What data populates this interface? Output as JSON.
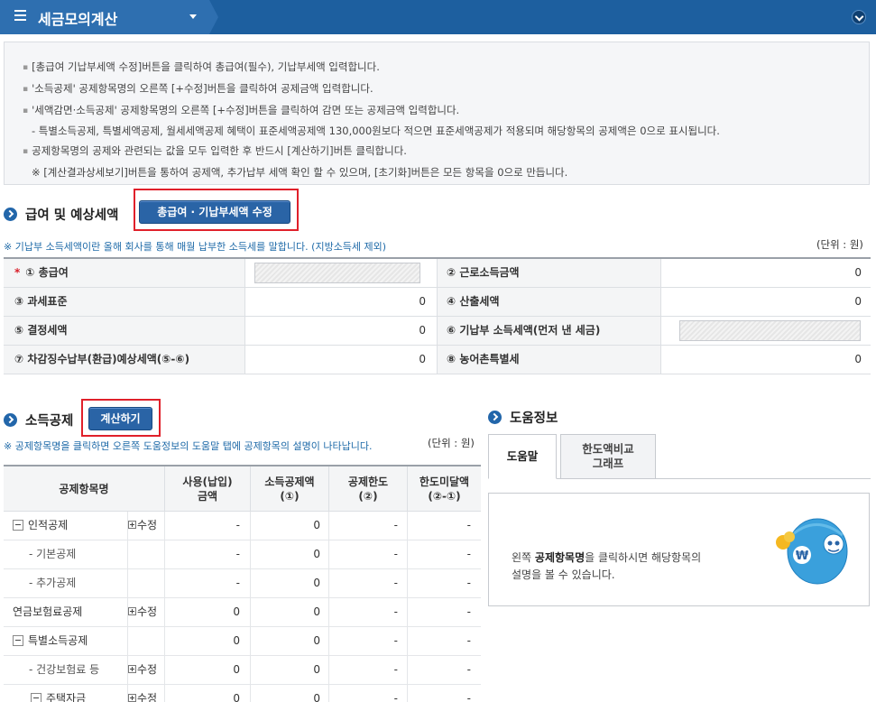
{
  "header": {
    "title": "세금모의계산"
  },
  "notice": {
    "lines": [
      "[총급여 기납부세액 수정]버튼을 클릭하여 총급여(필수), 기납부세액 입력합니다.",
      "'소득공제' 공제항목명의 오른쪽 [+수정]버튼을 클릭하여 공제금액 입력합니다.",
      "'세액감면·소득공제' 공제항목명의 오른쪽 [+수정]버튼을 클릭하여 감면 또는 공제금액 입력합니다.",
      "- 특별소득공제, 특별세액공제, 월세세액공제 혜택이 표준세액공제액 130,000원보다 적으면 표준세액공제가 적용되며 해당항목의 공제액은 0으로 표시됩니다.",
      "공제항목명의 공제와 관련되는 값을 모두 입력한 후 반드시 [계산하기]버튼 클릭합니다.",
      "※ [계산결과상세보기]버튼을 통하여 공제액, 추가납부 세액 확인 할 수 있으며, [초기화]버튼은 모든 항목을 0으로 만듭니다."
    ]
  },
  "salary": {
    "title": "급여 및 예상세액",
    "edit_button": "총급여 · 기납부세액 수정",
    "note": "※ 기납부 소득세액이란 올해 회사를 통해 매월 납부한 소득세를 말합니다. (지방소득세 제외)",
    "unit": "(단위 : 원)",
    "required_mark": "*",
    "rows": [
      {
        "label1": "① 총급여",
        "value1": "",
        "label2": "② 근로소득금액",
        "value2": "0"
      },
      {
        "label1": "③ 과세표준",
        "value1": "0",
        "label2": "④ 산출세액",
        "value2": "0"
      },
      {
        "label1": "⑤ 결정세액",
        "value1": "0",
        "label2": "⑥ 기납부 소득세액(먼저 낸 세금)",
        "value2": ""
      },
      {
        "label1": "⑦ 차감징수납부(환급)예상세액(⑤-⑥)",
        "value1": "0",
        "label2": "⑧ 농어촌특별세",
        "value2": "0"
      }
    ]
  },
  "deduction": {
    "title": "소득공제",
    "calc_button": "계산하기",
    "note": "※ 공제항목명을 클릭하면 오른쪽 도움정보의 도움말 탭에 공제항목의 설명이 나타납니다.",
    "unit": "(단위 : 원)",
    "headers": {
      "name": "공제항목명",
      "usage_1": "사용(납입)",
      "usage_2": "금액",
      "amount_1": "소득공제액",
      "amount_2": "(①)",
      "limit_1": "공제한도",
      "limit_2": "(②)",
      "remain_1": "한도미달액",
      "remain_2": "(②-①)"
    },
    "rows": [
      {
        "name": "인적공제",
        "edit": "수정",
        "usage": "-",
        "amount": "0",
        "limit": "-",
        "remain": "-"
      },
      {
        "name": "- 기본공제",
        "edit": "",
        "usage": "-",
        "amount": "0",
        "limit": "-",
        "remain": "-"
      },
      {
        "name": "- 추가공제",
        "edit": "",
        "usage": "-",
        "amount": "0",
        "limit": "-",
        "remain": "-"
      },
      {
        "name": "연금보험료공제",
        "edit": "수정",
        "usage": "0",
        "amount": "0",
        "limit": "-",
        "remain": "-"
      },
      {
        "name": "특별소득공제",
        "edit": "",
        "usage": "0",
        "amount": "0",
        "limit": "-",
        "remain": "-"
      },
      {
        "name": "- 건강보험료 등",
        "edit": "수정",
        "usage": "0",
        "amount": "0",
        "limit": "-",
        "remain": "-"
      },
      {
        "name": "주택자금",
        "edit": "수정",
        "usage": "0",
        "amount": "0",
        "limit": "-",
        "remain": "-"
      }
    ]
  },
  "help": {
    "title": "도움정보",
    "tab_help": "도움말",
    "tab_compare_1": "한도액비교",
    "tab_compare_2": "그래프",
    "text_prefix": "왼쪽 ",
    "text_bold": "공제항목명",
    "text_suffix": "을 클릭하시면 해당항목의",
    "text_line2": "설명을 볼 수 있습니다."
  },
  "colors": {
    "header": "#1d5f9f",
    "button": "#2a64a6",
    "highlight": "#e0202a",
    "note": "#1e6aa8"
  }
}
